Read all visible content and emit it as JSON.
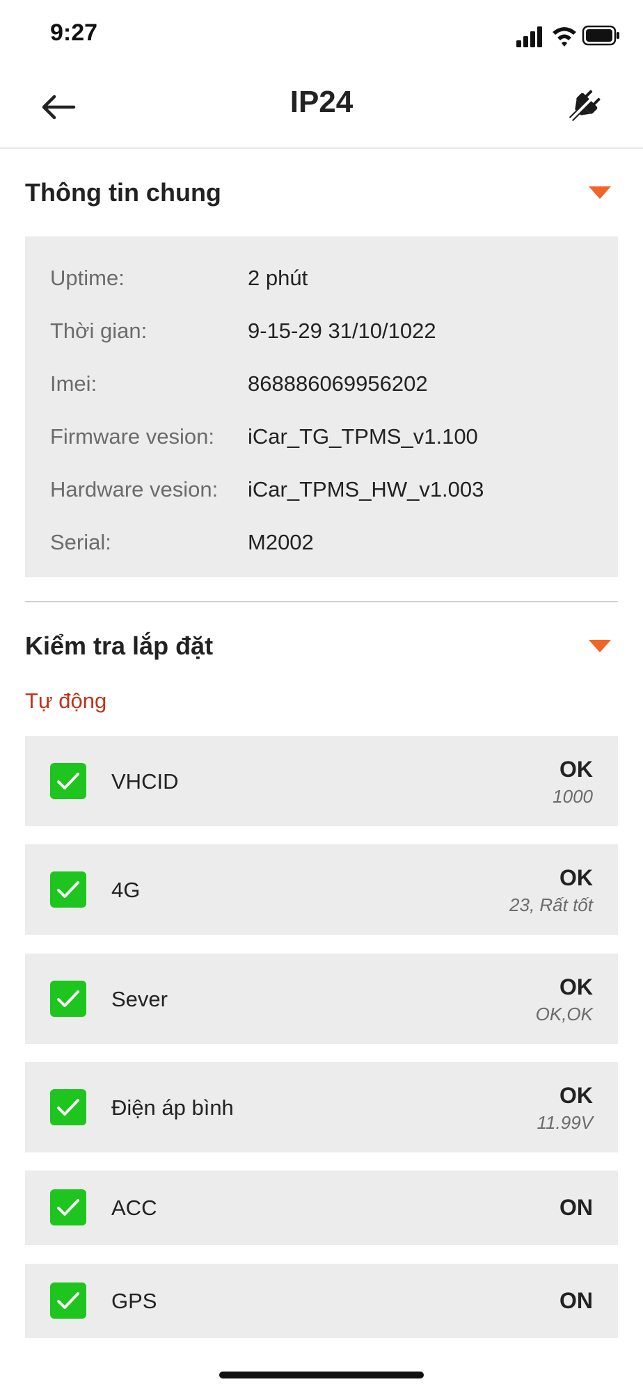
{
  "status_bar": {
    "time": "9:27"
  },
  "header": {
    "title": "IP24"
  },
  "general_info": {
    "title": "Thông tin chung",
    "rows": [
      {
        "key": "Uptime:",
        "value": "2 phút"
      },
      {
        "key": "Thời gian:",
        "value": "9-15-29 31/10/1022"
      },
      {
        "key": "Imei:",
        "value": "868886069956202"
      },
      {
        "key": "Firmware vesion:",
        "value": "iCar_TG_TPMS_v1.100"
      },
      {
        "key": "Hardware vesion:",
        "value": "iCar_TPMS_HW_v1.003"
      },
      {
        "key": "Serial:",
        "value": "M2002"
      }
    ]
  },
  "install_check": {
    "title": "Kiểm tra lắp đặt",
    "subtitle": "Tự động",
    "items": [
      {
        "label": "VHCID",
        "status": "OK",
        "detail": "1000",
        "checked": true
      },
      {
        "label": "4G",
        "status": "OK",
        "detail": "23, Rất tốt",
        "checked": true
      },
      {
        "label": "Sever",
        "status": "OK",
        "detail": "OK,OK",
        "checked": true
      },
      {
        "label": "Điện áp bình",
        "status": "OK",
        "detail": "11.99V",
        "checked": true
      },
      {
        "label": "ACC",
        "status": "ON",
        "checked": true
      },
      {
        "label": "GPS",
        "status": "ON",
        "checked": true
      }
    ]
  },
  "colors": {
    "accent": "#f26427",
    "subtitle": "#c0331a",
    "check_green": "#1ec51e",
    "card_bg": "#ececec"
  }
}
